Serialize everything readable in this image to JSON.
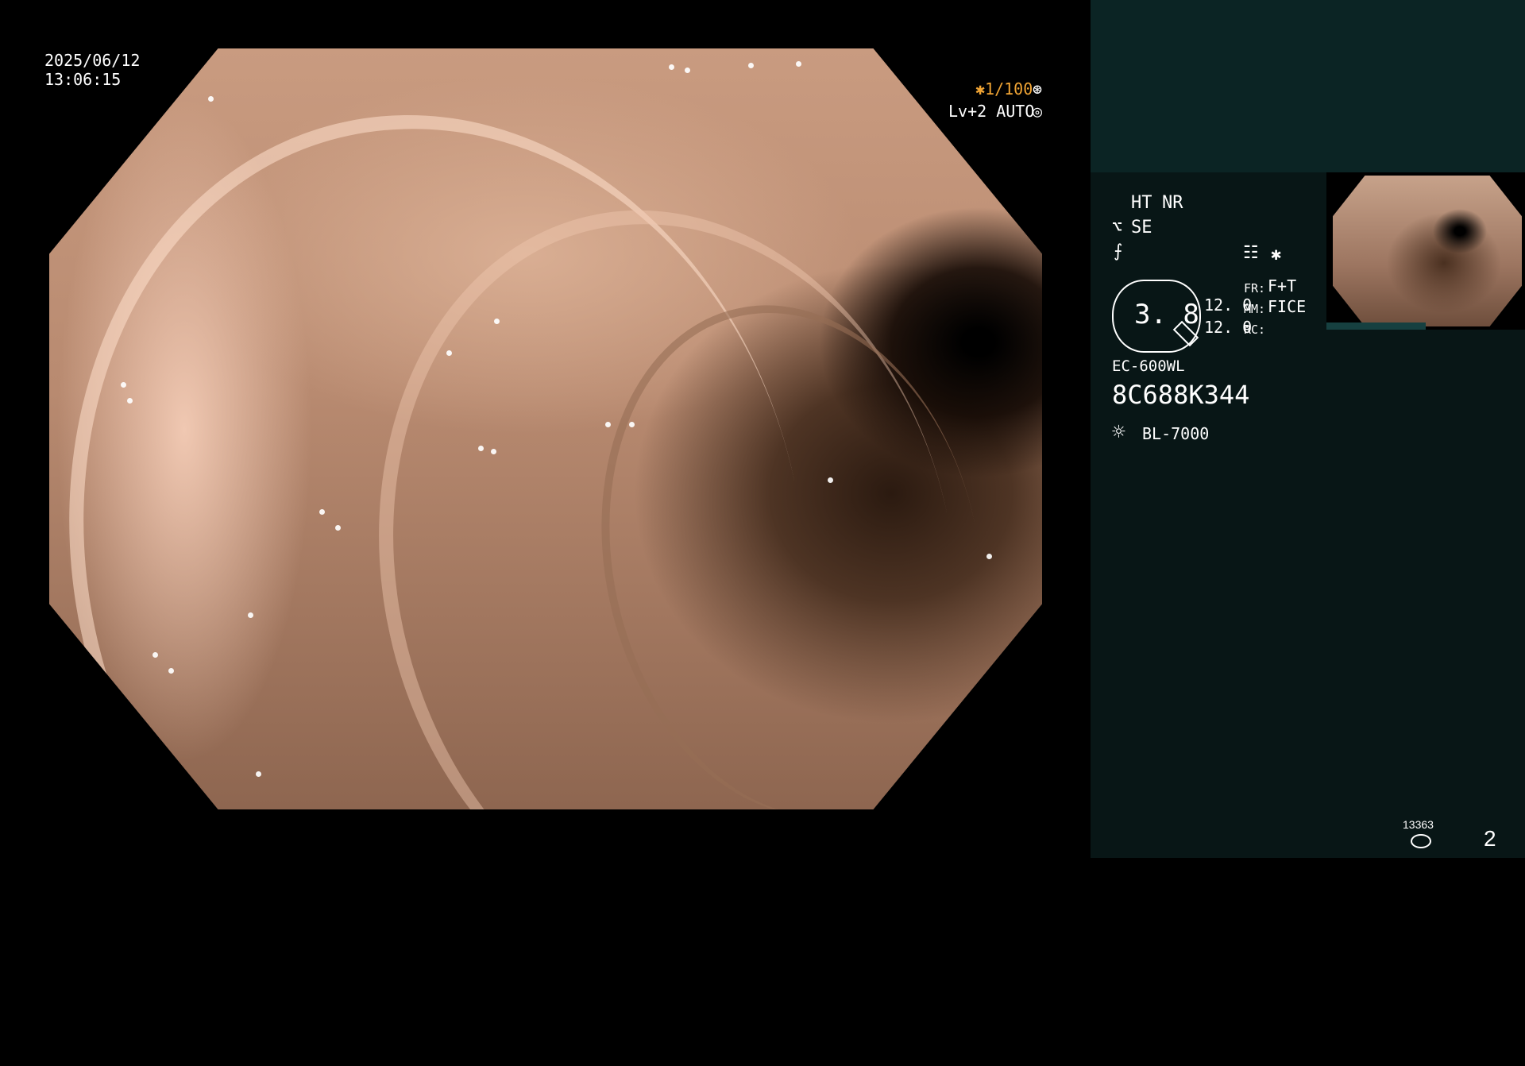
{
  "overlay": {
    "date": "2025/06/12",
    "time": "13:06:15",
    "shutter": "✱1/100",
    "shutter_icon": "⊛",
    "level": "Lv+2 AUTO",
    "level_icon": "◎"
  },
  "panel": {
    "ht": "HT",
    "nr": "NR",
    "se_icon": "⌥",
    "se": "SE",
    "f_icon": "⨍",
    "menu_icon": "☷",
    "asterisk": "✱",
    "zoom_value": "3. 8",
    "value_a": "12. 0",
    "value_b": "12. 0",
    "fr_label": "FR:",
    "fr_value": "F+T",
    "mm_label": "MM:",
    "mm_value": "FICE",
    "rc_label": "RC:",
    "scope_model": "EC-600WL",
    "serial": "8C688K344",
    "light_icon": "☼",
    "light_source": "BL-7000",
    "counter": "13363",
    "page": "2"
  },
  "colors": {
    "accent_orange": "#f0a434",
    "panel_top": "#0b2424",
    "panel_bg": "#081616"
  }
}
